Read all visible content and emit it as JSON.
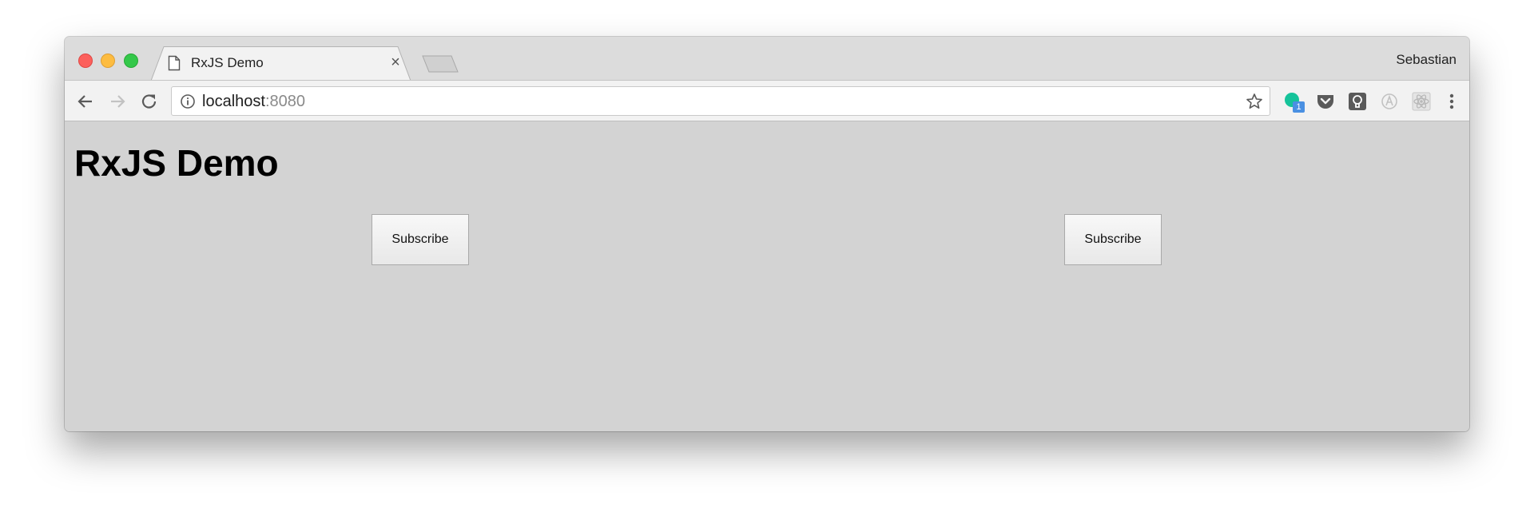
{
  "browser": {
    "tab_title": "RxJS Demo",
    "tab_close": "×",
    "profile_name": "Sebastian",
    "address": {
      "host": "localhost",
      "port": ":8080"
    },
    "extension_badge": "1"
  },
  "page": {
    "heading": "RxJS Demo",
    "buttons": [
      {
        "label": "Subscribe"
      },
      {
        "label": "Subscribe"
      }
    ]
  },
  "colors": {
    "page_background": "#d3d3d3",
    "titlebar": "#dcdcdc",
    "toolbar": "#f2f2f2",
    "close": "#fc605c",
    "minimize": "#fdbc40",
    "maximize": "#34c84a"
  },
  "icons": [
    "document-icon",
    "close-icon",
    "back-icon",
    "forward-icon",
    "reload-icon",
    "info-icon",
    "star-icon",
    "grammarly-icon",
    "pocket-icon",
    "lightbulb-icon",
    "angular-icon",
    "react-icon",
    "menu-icon"
  ]
}
